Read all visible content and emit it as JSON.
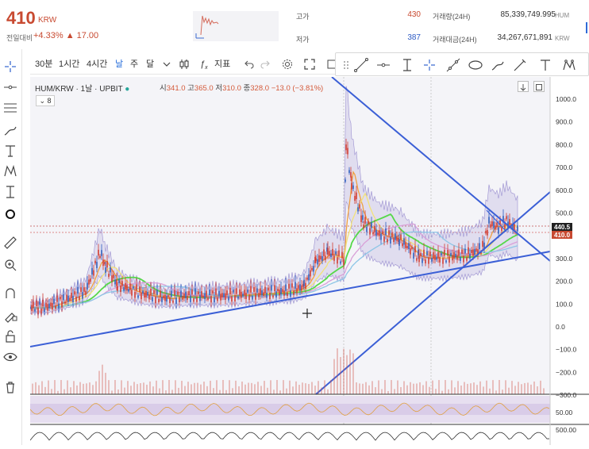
{
  "header": {
    "price": "410",
    "currency": "KRW",
    "change_label": "전일대비",
    "change_pct": "+4.33%",
    "change_abs": "▲ 17.00",
    "high_label": "고가",
    "high_value": "430",
    "low_label": "저가",
    "low_value": "387",
    "vol_label": "거래량(24H)",
    "vol_value": "85,339,749.995",
    "vol_unit": "HUM",
    "amt_label": "거래대금(24H)",
    "amt_value": "34,267,671,891",
    "amt_unit": "KRW"
  },
  "toolbar": {
    "interval_30m": "30분",
    "interval_1h": "1시간",
    "interval_4h": "4시간",
    "interval_day": "날",
    "interval_week": "주",
    "interval_month": "달",
    "indicators_label": "지표",
    "indicators_icon": "fx-icon"
  },
  "chart": {
    "symbol_line": "HUM/KRW · 1날 · UPBIT",
    "ohlc": {
      "o_label": "시",
      "o": "341.0",
      "h_label": "고",
      "h": "365.0",
      "l_label": "저",
      "l": "310.0",
      "c_label": "종",
      "c": "328.0",
      "chg": "−13.0 (−3.81%)"
    },
    "indicator_count": "8",
    "y_axis_ticks": [
      "1000.0",
      "900.0",
      "800.0",
      "700.0",
      "600.0",
      "500.0",
      "400.0",
      "300.0",
      "200.0",
      "100.0",
      "0.0",
      "−100.0",
      "−200.0",
      "−300.0"
    ],
    "last_price_tag": "410.0",
    "crosshair_price_tag": "440.5",
    "rsi_tick": "50.00",
    "bottom_tick": "500.00",
    "colors": {
      "candle_up": "#d23b2f",
      "candle_down": "#2d5fbf",
      "bollinger": "#9a8fd0",
      "trendline": "#3b5fd6",
      "ma_orange": "#f0a040",
      "ma_yellow": "#f2e27a",
      "ma_green": "#56d84a",
      "ma_pink": "#d9a0d8",
      "ma_lightblue": "#8ec6e6",
      "accent": "#c84a31"
    }
  }
}
